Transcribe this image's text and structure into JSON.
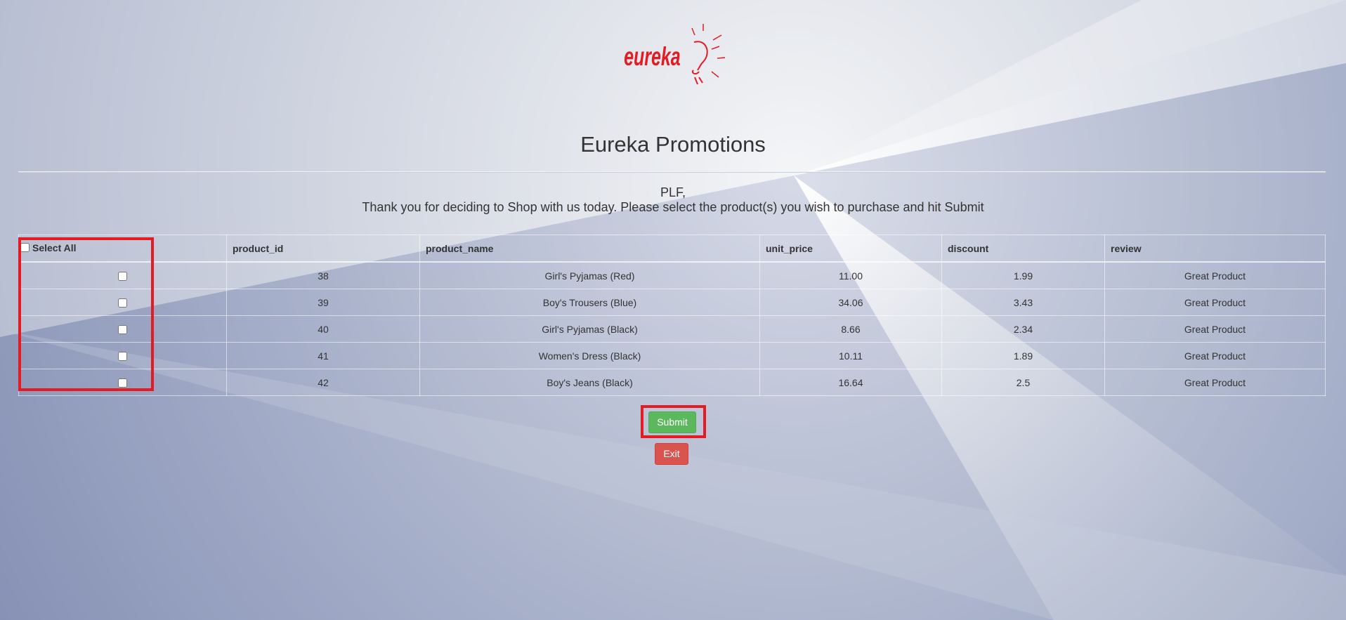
{
  "brand": {
    "logo_text": "eureka",
    "logo_color": "#e31b23"
  },
  "page_title": "Eureka Promotions",
  "greeting": {
    "name_line": "PLF,",
    "message": "Thank you for deciding to Shop with us today. Please select the product(s) you wish to purchase and hit Submit"
  },
  "table": {
    "select_all_label": "Select All",
    "columns": [
      "product_id",
      "product_name",
      "unit_price",
      "discount",
      "review"
    ],
    "rows": [
      {
        "product_id": "38",
        "product_name": "Girl's Pyjamas (Red)",
        "unit_price": "11.00",
        "discount": "1.99",
        "review": "Great Product"
      },
      {
        "product_id": "39",
        "product_name": "Boy's Trousers (Blue)",
        "unit_price": "34.06",
        "discount": "3.43",
        "review": "Great Product"
      },
      {
        "product_id": "40",
        "product_name": "Girl's Pyjamas (Black)",
        "unit_price": "8.66",
        "discount": "2.34",
        "review": "Great Product"
      },
      {
        "product_id": "41",
        "product_name": "Women's Dress (Black)",
        "unit_price": "10.11",
        "discount": "1.89",
        "review": "Great Product"
      },
      {
        "product_id": "42",
        "product_name": "Boy's Jeans (Black)",
        "unit_price": "16.64",
        "discount": "2.5",
        "review": "Great Product"
      }
    ]
  },
  "buttons": {
    "submit_label": "Submit",
    "exit_label": "Exit",
    "submit_color": "#5cb85c",
    "exit_color": "#d9534f"
  },
  "highlight_color": "#e31b23"
}
